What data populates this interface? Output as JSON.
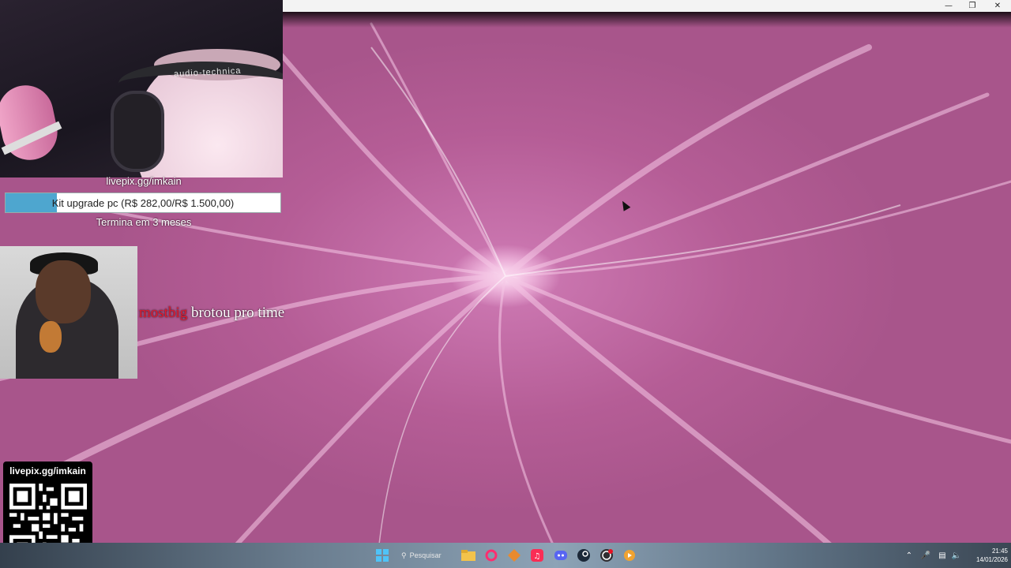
{
  "window": {
    "minimize_icon": "minimize-icon",
    "maximize_icon": "restore-icon",
    "close_icon": "close-icon"
  },
  "webcam": {
    "headphone_brand": "audio-technica"
  },
  "goal": {
    "url": "livepix.gg/imkain",
    "label": "Kit upgrade pc (R$ 282,00/R$ 1.500,00)",
    "current": 282,
    "target": 1500,
    "progress_fraction": 0.188,
    "ends": "Termina em 3 meses",
    "fill_color": "#4ea6cf"
  },
  "alert": {
    "username": "mostbig",
    "message": " brotou pro time",
    "username_color": "#e0192e"
  },
  "qr": {
    "url": "livepix.gg/imkain"
  },
  "taskbar": {
    "search_label": "Pesquisar",
    "apps": [
      {
        "name": "windows-start-icon"
      },
      {
        "name": "file-explorer-icon"
      },
      {
        "name": "opera-gx-icon"
      },
      {
        "name": "app-icon"
      },
      {
        "name": "apple-music-icon"
      },
      {
        "name": "discord-icon"
      },
      {
        "name": "steam-icon"
      },
      {
        "name": "obs-icon"
      },
      {
        "name": "media-player-icon"
      }
    ],
    "time": "21:45",
    "date": "14/01/2026"
  }
}
